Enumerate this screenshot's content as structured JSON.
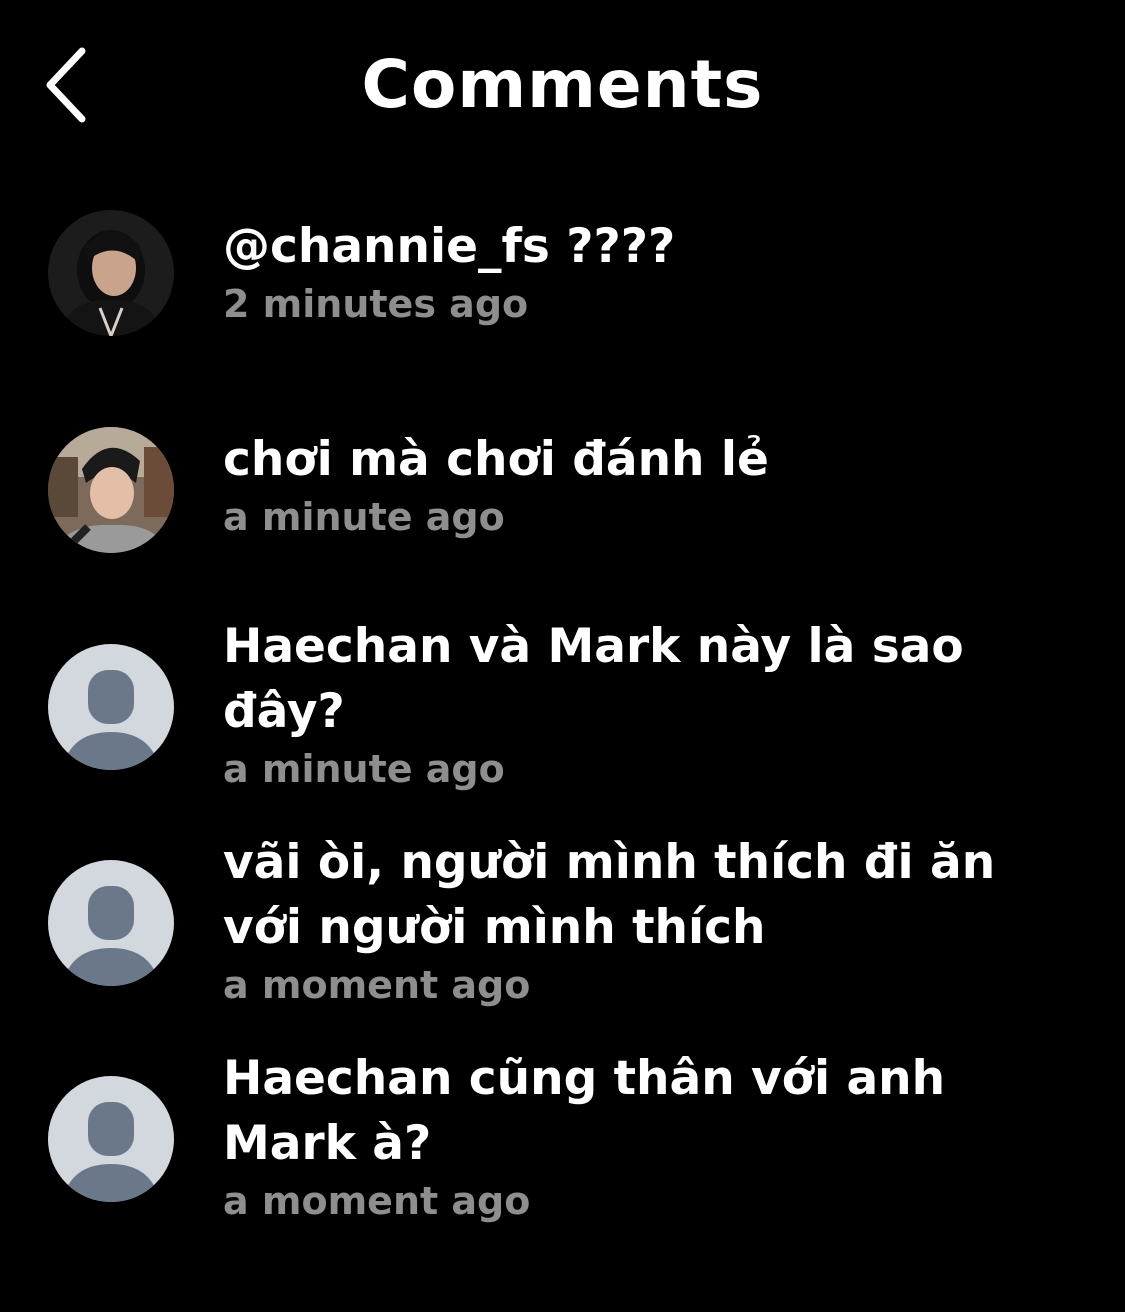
{
  "header": {
    "title": "Comments",
    "back_icon": "chevron-left-icon"
  },
  "comments": [
    {
      "text": "@channie_fs ????",
      "time": "2 minutes ago",
      "avatar": "photo"
    },
    {
      "text": "chơi mà chơi đánh lẻ",
      "time": "a minute ago",
      "avatar": "photo"
    },
    {
      "text": "Haechan và Mark này là sao đây?",
      "time": "a minute ago",
      "avatar": "default-person-icon"
    },
    {
      "text": "vãi òi, người mình thích đi ăn với người mình thích",
      "time": "a moment ago",
      "avatar": "default-person-icon"
    },
    {
      "text": "Haechan cũng thân với anh Mark à?",
      "time": "a moment ago",
      "avatar": "default-person-icon"
    }
  ],
  "colors": {
    "background": "#000000",
    "text": "#ffffff",
    "timestamp": "#8e8e8e",
    "default_avatar_bg": "#d3d8de",
    "default_avatar_fg": "#6b7889"
  }
}
